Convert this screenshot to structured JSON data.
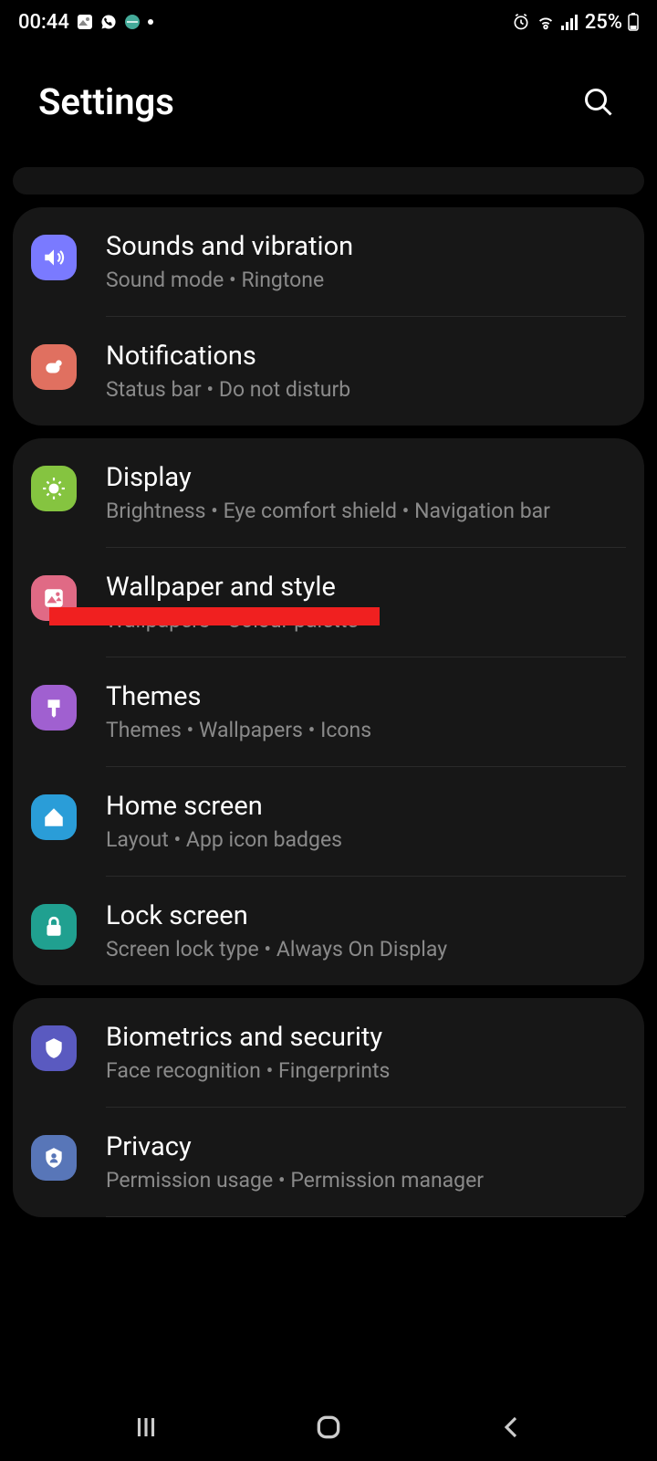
{
  "statusBar": {
    "time": "00:44",
    "battery": "25%"
  },
  "header": {
    "title": "Settings"
  },
  "groups": [
    {
      "items": [
        {
          "id": "sounds",
          "title": "Sounds and vibration",
          "subtitle": "Sound mode  •  Ringtone"
        },
        {
          "id": "notifications",
          "title": "Notifications",
          "subtitle": "Status bar  •  Do not disturb"
        }
      ]
    },
    {
      "items": [
        {
          "id": "display",
          "title": "Display",
          "subtitle": "Brightness  •  Eye comfort shield  •  Navigation bar"
        },
        {
          "id": "wallpaper",
          "title": "Wallpaper and style",
          "subtitle": "Wallpapers  •  Colour palette"
        },
        {
          "id": "themes",
          "title": "Themes",
          "subtitle": "Themes  •  Wallpapers  •  Icons"
        },
        {
          "id": "homescreen",
          "title": "Home screen",
          "subtitle": "Layout  •  App icon badges"
        },
        {
          "id": "lockscreen",
          "title": "Lock screen",
          "subtitle": "Screen lock type  •  Always On Display"
        }
      ]
    },
    {
      "items": [
        {
          "id": "biometrics",
          "title": "Biometrics and security",
          "subtitle": "Face recognition  •  Fingerprints"
        },
        {
          "id": "privacy",
          "title": "Privacy",
          "subtitle": "Permission usage  •  Permission manager"
        }
      ]
    }
  ]
}
